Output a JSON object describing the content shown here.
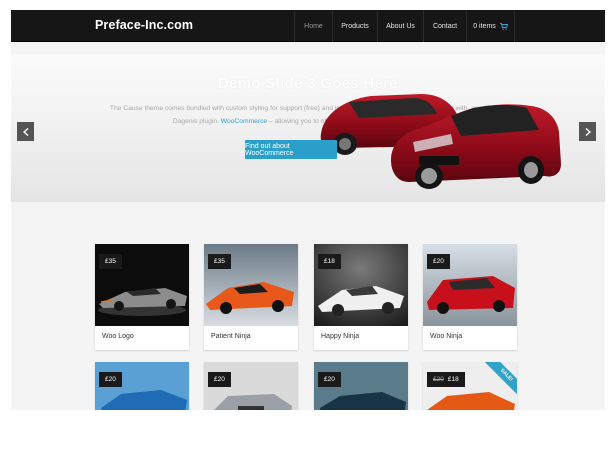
{
  "header": {
    "logo": "Preface-Inc.com",
    "nav": [
      {
        "label": "Home",
        "active": true
      },
      {
        "label": "Products",
        "active": false
      },
      {
        "label": "About Us",
        "active": false
      },
      {
        "label": "Contact",
        "active": false
      },
      {
        "label": "0 items",
        "active": false,
        "icon": "cart-icon"
      }
    ]
  },
  "slider": {
    "title": "Demo Slide 3 Goes Here",
    "text_before": "The Cause theme comes bundled with custom styling for support (free) and is compatible and gets it comes bundled with, as well as our Dagenis plugin.",
    "link_text": "WooCommerce",
    "text_after": "– allowing you to offer eCommerce facility from your website.",
    "button_label": "Find out about WooCommerce",
    "prev_icon": "chevron-left-icon",
    "next_icon": "chevron-right-icon"
  },
  "products": [
    {
      "name": "Woo Logo",
      "price": "£35",
      "sale": false
    },
    {
      "name": "Patient Ninja",
      "price": "£35",
      "sale": false
    },
    {
      "name": "Happy Ninja",
      "price": "£18",
      "sale": false
    },
    {
      "name": "Woo Ninja",
      "price": "£20",
      "sale": false
    },
    {
      "name": "",
      "price": "£20",
      "sale": false
    },
    {
      "name": "",
      "price": "£20",
      "sale": false
    },
    {
      "name": "",
      "price": "£20",
      "sale": false
    },
    {
      "name": "",
      "price": "£18",
      "old_price": "£20",
      "sale": true,
      "sale_label": "SALE!"
    }
  ],
  "colors": {
    "accent": "#2a9fc9",
    "header_bg": "#161616"
  }
}
